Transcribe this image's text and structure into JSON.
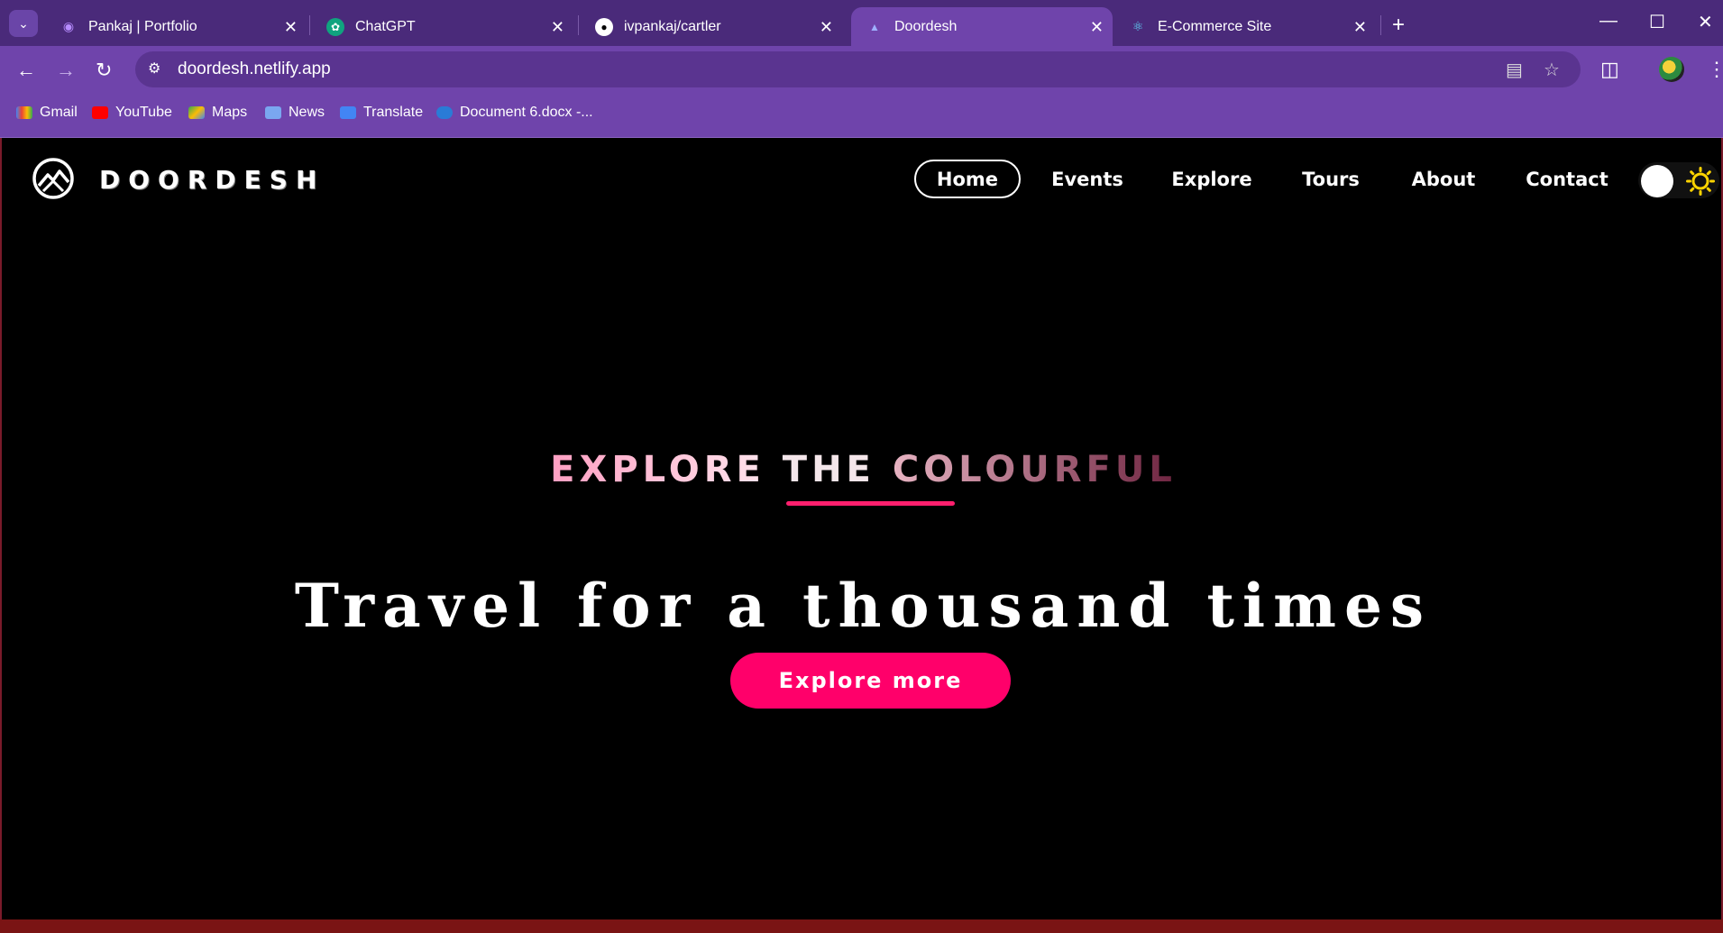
{
  "browser": {
    "tabs": [
      {
        "title": "Pankaj | Portfolio",
        "icon": "portfolio-icon"
      },
      {
        "title": "ChatGPT",
        "icon": "chatgpt-icon"
      },
      {
        "title": "ivpankaj/cartler",
        "icon": "github-icon"
      },
      {
        "title": "Doordesh",
        "icon": "doordesh-icon",
        "active": true
      },
      {
        "title": "E-Commerce Site",
        "icon": "react-icon"
      }
    ],
    "url": "doordesh.netlify.app",
    "bookmarks": [
      {
        "label": "Gmail",
        "icon": "gmail-icon"
      },
      {
        "label": "YouTube",
        "icon": "youtube-icon"
      },
      {
        "label": "Maps",
        "icon": "maps-icon"
      },
      {
        "label": "News",
        "icon": "news-icon"
      },
      {
        "label": "Translate",
        "icon": "translate-icon"
      },
      {
        "label": "Document 6.docx -...",
        "icon": "onedrive-icon"
      }
    ],
    "colors": {
      "tabbar": "#4a2a7a",
      "toolbar": "#6f44ab"
    }
  },
  "site": {
    "brand": "DOORDESH",
    "nav": [
      {
        "label": "Home",
        "active": true
      },
      {
        "label": "Events"
      },
      {
        "label": "Explore"
      },
      {
        "label": "Tours"
      },
      {
        "label": "About"
      },
      {
        "label": "Contact"
      }
    ],
    "theme_toggle": {
      "state": "dark",
      "icon": "sun-icon"
    }
  },
  "hero": {
    "kicker_words": [
      "EXPLORE",
      "THE",
      "COLOURFUL"
    ],
    "title": "Travel for a thousand times",
    "cta_label": "Explore more",
    "colors": {
      "accent": "#ff006a",
      "kicker_start": "#ff8fb3",
      "kicker_end": "#7a2a45"
    }
  }
}
